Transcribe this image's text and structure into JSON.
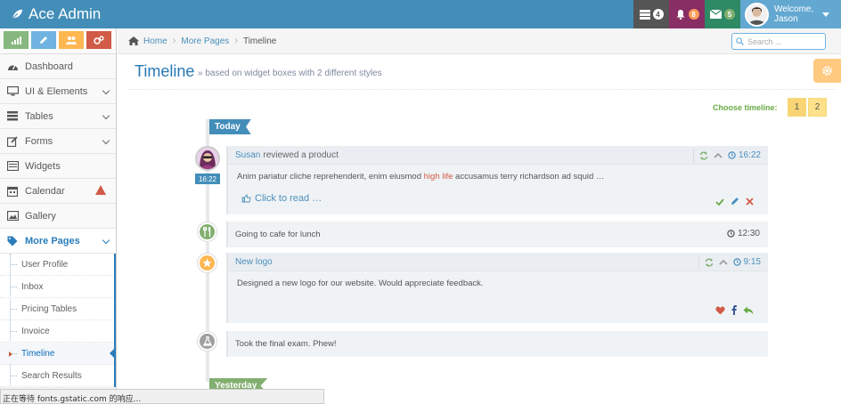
{
  "app": {
    "brand": "Ace Admin"
  },
  "navbar": {
    "tasks_count": "4",
    "notifications_count": "8",
    "messages_count": "5",
    "user_greeting": "Welcome,",
    "user_name": "Jason"
  },
  "sidebar": {
    "items": [
      {
        "label": "Dashboard"
      },
      {
        "label": "UI & Elements"
      },
      {
        "label": "Tables"
      },
      {
        "label": "Forms"
      },
      {
        "label": "Widgets"
      },
      {
        "label": "Calendar"
      },
      {
        "label": "Gallery"
      },
      {
        "label": "More Pages"
      }
    ],
    "submenu": [
      {
        "label": "User Profile"
      },
      {
        "label": "Inbox"
      },
      {
        "label": "Pricing Tables"
      },
      {
        "label": "Invoice"
      },
      {
        "label": "Timeline"
      },
      {
        "label": "Search Results"
      }
    ]
  },
  "breadcrumb": {
    "home": "Home",
    "parent": "More Pages",
    "current": "Timeline"
  },
  "search": {
    "placeholder": "Search ..."
  },
  "page": {
    "title": "Timeline",
    "subtitle": "» based on widget boxes with 2 different styles"
  },
  "timeline_chooser": {
    "label": "Choose timeline:",
    "options": [
      "1",
      "2"
    ]
  },
  "timeline": {
    "today_label": "Today",
    "yesterday_label": "Yesterday",
    "items": [
      {
        "user": "Susan",
        "action": "reviewed a product",
        "time": "16:22",
        "body_before": "Anim pariatur cliche reprehenderit, enim eiusmod ",
        "body_highlight": "high life",
        "body_after": " accusamus terry richardson ad squid …",
        "read_more": "Click to read …"
      },
      {
        "text": "Going to cafe for lunch",
        "time": "12:30"
      },
      {
        "title": "New logo",
        "time": "9:15",
        "body": "Designed a new logo for our website. Would appreciate feedback."
      },
      {
        "text": "Took the final exam. Phew!"
      }
    ]
  },
  "statusbar": {
    "text": "正在等待 fonts.gstatic.com 的响应..."
  },
  "colors": {
    "navbar": "#438eb9",
    "accent": "#2679b5",
    "highlight": "#d15b47",
    "today": "#438eb9",
    "yesterday": "#82af6f"
  }
}
